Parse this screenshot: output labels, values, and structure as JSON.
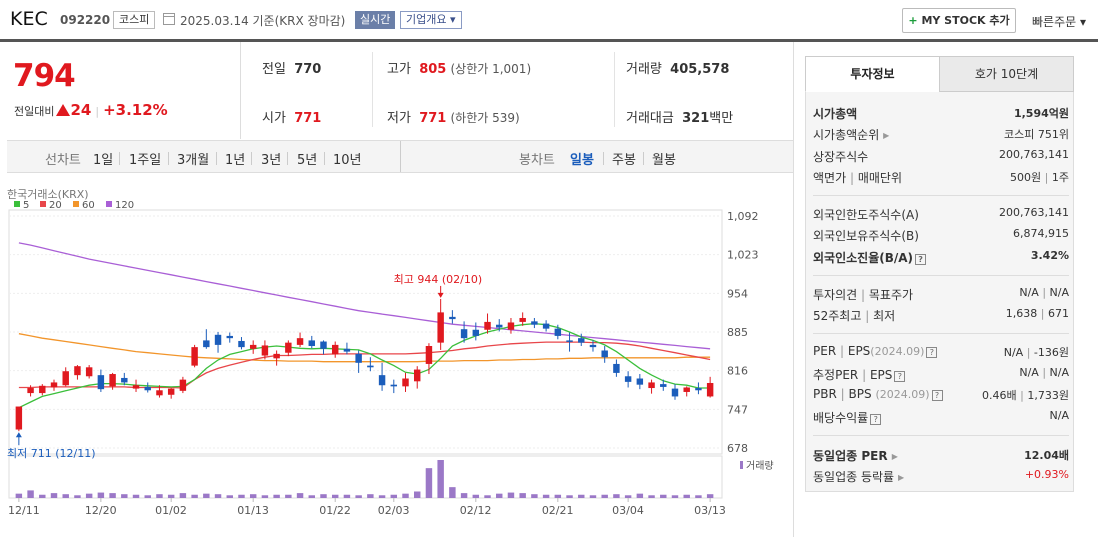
{
  "header": {
    "name": "KEC",
    "code": "092220",
    "market": "코스피",
    "date": "2025.03.14 기준(KRX 장마감)",
    "realtime": "실시간",
    "corp_overview": "기업개요 ▾",
    "mystock": "MY STOCK 추가",
    "mystock_plus": "+",
    "quick_order": "빠른주문 ▾"
  },
  "price": {
    "current": "794",
    "change_label": "전일대비",
    "change": "24",
    "change_pct": "+3.12%"
  },
  "stats": {
    "prev_label": "전일",
    "prev": "770",
    "high_label": "고가",
    "high": "805",
    "upper_limit": "(상한가 1,001)",
    "vol_label": "거래량",
    "vol": "405,578",
    "open_label": "시가",
    "open": "771",
    "low_label": "저가",
    "low": "771",
    "lower_limit": "(하한가 539)",
    "amount_label": "거래대금",
    "amount": "321",
    "amount_unit": "백만"
  },
  "period_bar": {
    "line_label": "선차트",
    "line_opts": [
      "1일",
      "1주일",
      "3개월",
      "1년",
      "3년",
      "5년",
      "10년"
    ],
    "candle_label": "봉차트",
    "candle_opts": [
      "일봉",
      "주봉",
      "월봉"
    ],
    "candle_active": "일봉"
  },
  "chart_data": {
    "type": "candlestick",
    "source": "한국거래소(KRX)",
    "legend": [
      {
        "name": "5",
        "color": "#3bbf3b"
      },
      {
        "name": "20",
        "color": "#e8464a"
      },
      {
        "name": "60",
        "color": "#f2952b"
      },
      {
        "name": "120",
        "color": "#a95fd6"
      }
    ],
    "y_ticks": [
      1092,
      1023,
      954,
      885,
      816,
      747,
      678
    ],
    "ylim": [
      678,
      1092
    ],
    "x_ticks": [
      "12/11",
      "12/20",
      "01/02",
      "01/13",
      "01/22",
      "02/03",
      "02/12",
      "02/21",
      "03/04",
      "03/13"
    ],
    "annotation_high": "최고 944 (02/10)",
    "annotation_low": "최저 711 (12/11)",
    "volume_label": "거래량",
    "candles": [
      {
        "o": 711,
        "h": 722,
        "l": 708,
        "c": 752,
        "up": true
      },
      {
        "o": 776,
        "h": 790,
        "l": 770,
        "c": 785,
        "up": true
      },
      {
        "o": 776,
        "h": 792,
        "l": 772,
        "c": 789,
        "up": true
      },
      {
        "o": 786,
        "h": 800,
        "l": 780,
        "c": 795,
        "up": true
      },
      {
        "o": 790,
        "h": 822,
        "l": 788,
        "c": 815,
        "up": true
      },
      {
        "o": 808,
        "h": 826,
        "l": 800,
        "c": 824,
        "up": true
      },
      {
        "o": 806,
        "h": 826,
        "l": 802,
        "c": 822,
        "up": true
      },
      {
        "o": 808,
        "h": 818,
        "l": 778,
        "c": 783,
        "up": false
      },
      {
        "o": 788,
        "h": 812,
        "l": 782,
        "c": 810,
        "up": true
      },
      {
        "o": 803,
        "h": 812,
        "l": 790,
        "c": 795,
        "up": false
      },
      {
        "o": 784,
        "h": 800,
        "l": 778,
        "c": 790,
        "up": true
      },
      {
        "o": 787,
        "h": 795,
        "l": 777,
        "c": 781,
        "up": false
      },
      {
        "o": 772,
        "h": 790,
        "l": 768,
        "c": 781,
        "up": true
      },
      {
        "o": 773,
        "h": 785,
        "l": 766,
        "c": 784,
        "up": true
      },
      {
        "o": 780,
        "h": 805,
        "l": 776,
        "c": 800,
        "up": true
      },
      {
        "o": 825,
        "h": 862,
        "l": 822,
        "c": 858,
        "up": true
      },
      {
        "o": 870,
        "h": 890,
        "l": 855,
        "c": 858,
        "up": false
      },
      {
        "o": 862,
        "h": 885,
        "l": 848,
        "c": 880,
        "up": false
      },
      {
        "o": 874,
        "h": 884,
        "l": 866,
        "c": 878,
        "up": false
      },
      {
        "o": 869,
        "h": 876,
        "l": 854,
        "c": 858,
        "up": false
      },
      {
        "o": 855,
        "h": 870,
        "l": 846,
        "c": 862,
        "up": true
      },
      {
        "o": 843,
        "h": 870,
        "l": 836,
        "c": 861,
        "up": true
      },
      {
        "o": 838,
        "h": 852,
        "l": 825,
        "c": 846,
        "up": true
      },
      {
        "o": 848,
        "h": 870,
        "l": 842,
        "c": 866,
        "up": true
      },
      {
        "o": 862,
        "h": 884,
        "l": 858,
        "c": 874,
        "up": true
      },
      {
        "o": 870,
        "h": 878,
        "l": 856,
        "c": 860,
        "up": false
      },
      {
        "o": 855,
        "h": 870,
        "l": 845,
        "c": 868,
        "up": false
      },
      {
        "o": 845,
        "h": 868,
        "l": 839,
        "c": 862,
        "up": true
      },
      {
        "o": 855,
        "h": 866,
        "l": 845,
        "c": 850,
        "up": false
      },
      {
        "o": 830,
        "h": 852,
        "l": 812,
        "c": 846,
        "up": false
      },
      {
        "o": 825,
        "h": 840,
        "l": 815,
        "c": 822,
        "up": false
      },
      {
        "o": 808,
        "h": 830,
        "l": 780,
        "c": 790,
        "up": false
      },
      {
        "o": 791,
        "h": 800,
        "l": 776,
        "c": 788,
        "up": false
      },
      {
        "o": 788,
        "h": 812,
        "l": 778,
        "c": 802,
        "up": true
      },
      {
        "o": 797,
        "h": 824,
        "l": 784,
        "c": 818,
        "up": true
      },
      {
        "o": 828,
        "h": 865,
        "l": 810,
        "c": 860,
        "up": true
      },
      {
        "o": 866,
        "h": 944,
        "l": 853,
        "c": 920,
        "up": true
      },
      {
        "o": 912,
        "h": 924,
        "l": 900,
        "c": 908,
        "up": false
      },
      {
        "o": 890,
        "h": 904,
        "l": 866,
        "c": 874,
        "up": false
      },
      {
        "o": 889,
        "h": 902,
        "l": 870,
        "c": 878,
        "up": false
      },
      {
        "o": 889,
        "h": 918,
        "l": 882,
        "c": 903,
        "up": true
      },
      {
        "o": 898,
        "h": 908,
        "l": 886,
        "c": 893,
        "up": false
      },
      {
        "o": 889,
        "h": 910,
        "l": 882,
        "c": 902,
        "up": true
      },
      {
        "o": 903,
        "h": 920,
        "l": 896,
        "c": 910,
        "up": true
      },
      {
        "o": 904,
        "h": 910,
        "l": 892,
        "c": 898,
        "up": false
      },
      {
        "o": 900,
        "h": 906,
        "l": 886,
        "c": 891,
        "up": false
      },
      {
        "o": 891,
        "h": 898,
        "l": 872,
        "c": 878,
        "up": false
      },
      {
        "o": 870,
        "h": 884,
        "l": 850,
        "c": 868,
        "up": false
      },
      {
        "o": 874,
        "h": 882,
        "l": 860,
        "c": 866,
        "up": false
      },
      {
        "o": 862,
        "h": 870,
        "l": 850,
        "c": 858,
        "up": false
      },
      {
        "o": 852,
        "h": 860,
        "l": 830,
        "c": 840,
        "up": false
      },
      {
        "o": 828,
        "h": 836,
        "l": 805,
        "c": 812,
        "up": false
      },
      {
        "o": 806,
        "h": 815,
        "l": 786,
        "c": 796,
        "up": false
      },
      {
        "o": 802,
        "h": 810,
        "l": 783,
        "c": 791,
        "up": false
      },
      {
        "o": 785,
        "h": 800,
        "l": 775,
        "c": 795,
        "up": true
      },
      {
        "o": 792,
        "h": 800,
        "l": 780,
        "c": 787,
        "up": false
      },
      {
        "o": 784,
        "h": 792,
        "l": 764,
        "c": 770,
        "up": false
      },
      {
        "o": 778,
        "h": 788,
        "l": 770,
        "c": 786,
        "up": true
      },
      {
        "o": 785,
        "h": 795,
        "l": 774,
        "c": 781,
        "up": false
      },
      {
        "o": 770,
        "h": 805,
        "l": 768,
        "c": 794,
        "up": true
      }
    ],
    "volumes": [
      8,
      14,
      6,
      9,
      7,
      5,
      8,
      10,
      9,
      7,
      6,
      5,
      7,
      6,
      9,
      6,
      8,
      7,
      5,
      6,
      7,
      5,
      6,
      6,
      9,
      5,
      7,
      6,
      6,
      5,
      7,
      5,
      6,
      8,
      12,
      55,
      70,
      20,
      9,
      6,
      5,
      8,
      10,
      9,
      7,
      6,
      6,
      5,
      6,
      5,
      6,
      7,
      5,
      8,
      5,
      6,
      5,
      6,
      5,
      7
    ],
    "ma5": [
      750,
      760,
      770,
      775,
      780,
      785,
      790,
      793,
      793,
      792,
      790,
      789,
      788,
      787,
      788,
      800,
      820,
      835,
      845,
      850,
      855,
      858,
      860,
      858,
      856,
      855,
      856,
      855,
      854,
      853,
      846,
      835,
      825,
      813,
      810,
      818,
      838,
      860,
      870,
      878,
      885,
      890,
      895,
      898,
      900,
      898,
      893,
      885,
      876,
      870,
      862,
      850,
      835,
      820,
      808,
      798,
      792,
      790,
      785,
      785
    ],
    "ma20": [
      786,
      786,
      787,
      787,
      787,
      787,
      787,
      787,
      787,
      787,
      786,
      786,
      786,
      786,
      785,
      800,
      812,
      820,
      826,
      831,
      836,
      840,
      843,
      843,
      844,
      845,
      845,
      846,
      846,
      846,
      846,
      846,
      846,
      846,
      847,
      848,
      850,
      852,
      855,
      857,
      860,
      862,
      864,
      865,
      866,
      867,
      867,
      867,
      867,
      866,
      866,
      865,
      863,
      860,
      856,
      852,
      848,
      844,
      840,
      836
    ],
    "ma60": [
      882,
      878,
      874,
      871,
      868,
      865,
      862,
      859,
      856,
      853,
      850,
      848,
      846,
      844,
      842,
      840,
      839,
      838,
      837,
      836,
      835,
      834,
      834,
      833,
      833,
      833,
      832,
      832,
      832,
      832,
      832,
      832,
      832,
      832,
      832,
      833,
      833,
      833,
      834,
      834,
      834,
      835,
      835,
      836,
      836,
      837,
      837,
      838,
      838,
      839,
      839,
      839,
      839,
      839,
      839,
      839,
      839,
      840,
      840,
      840
    ],
    "ma120": [
      1044,
      1040,
      1035,
      1030,
      1025,
      1020,
      1015,
      1011,
      1007,
      1003,
      999,
      995,
      991,
      987,
      983,
      979,
      975,
      971,
      967,
      963,
      959,
      955,
      951,
      947,
      943,
      939,
      935,
      931,
      927,
      923,
      920,
      917,
      914,
      911,
      908,
      905,
      902,
      899,
      897,
      895,
      893,
      891,
      889,
      887,
      885,
      883,
      881,
      879,
      877,
      875,
      873,
      871,
      869,
      867,
      865,
      863,
      861,
      859,
      857,
      855
    ]
  },
  "info": {
    "tab_active": "투자정보",
    "tab_other": "호가 10단계",
    "rows": {
      "mcap_k": "시가총액",
      "mcap_v": "1,594억원",
      "rank_k": "시가총액순위",
      "rank_v": "코스피 751위",
      "shares_k": "상장주식수",
      "shares_v": "200,763,141",
      "par_k1": "액면가",
      "par_k2": "매매단위",
      "par_v1": "500원",
      "par_v2": "1주",
      "forlimit_k": "외국인한도주식수(A)",
      "forlimit_v": "200,763,141",
      "forhold_k": "외국인보유주식수(B)",
      "forhold_v": "6,874,915",
      "forrate_k": "외국인소진율(B/A)",
      "forrate_v": "3.42%",
      "opinion_k1": "투자의견",
      "opinion_k2": "목표주가",
      "opinion_v1": "N/A",
      "opinion_v2": "N/A",
      "w52_k1": "52주최고",
      "w52_k2": "최저",
      "w52_v1": "1,638",
      "w52_v2": "671",
      "per_k1": "PER",
      "per_k2": "EPS",
      "per_k3": "(2024.09)",
      "per_v1": "N/A",
      "per_v2": "-136원",
      "eper_k1": "추정PER",
      "eper_k2": "EPS",
      "eper_v1": "N/A",
      "eper_v2": "N/A",
      "pbr_k1": "PBR",
      "pbr_k2": "BPS",
      "pbr_k3": "(2024.09)",
      "pbr_v1": "0.46배",
      "pbr_v2": "1,733원",
      "div_k": "배당수익률",
      "div_v": "N/A",
      "sper_k": "동일업종 PER",
      "sper_v": "12.04배",
      "srate_k": "동일업종 등락률",
      "srate_v": "+0.93%"
    }
  },
  "colors": {
    "up": "#e0191f",
    "down": "#1b5dbb",
    "accent_blue": "#6b7fa8"
  }
}
